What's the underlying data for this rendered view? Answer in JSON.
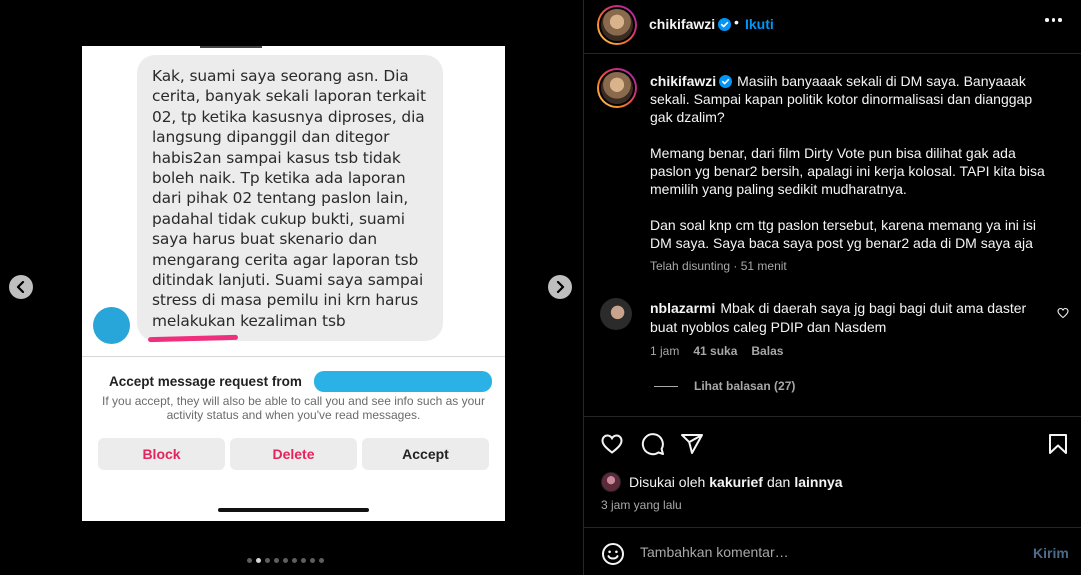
{
  "post": {
    "media": {
      "screenshot": {
        "message": "Kak, suami saya seorang asn. Dia cerita, banyak sekali laporan terkait 02, tp ketika kasusnya diproses, dia langsung dipanggil dan ditegor habis2an sampai kasus tsb tidak boleh naik. Tp ketika ada laporan dari pihak 02 tentang paslon lain, padahal tidak cukup bukti, suami saya harus buat skenario dan mengarang cerita agar laporan tsb ditindak lanjuti. Suami saya sampai stress di masa pemilu ini krn harus melakukan kezaliman tsb",
        "request_title": "Accept message request from",
        "request_info": "If you accept, they will also be able to call you and see info such as your activity status and when you've read messages.",
        "buttons": {
          "block": "Block",
          "delete": "Delete",
          "accept": "Accept"
        }
      },
      "carousel": {
        "total": 9,
        "active_index": 1
      }
    },
    "header": {
      "username": "chikifawzi",
      "separator": "•",
      "follow_label": "Ikuti"
    },
    "caption": {
      "username": "chikifawzi",
      "paragraphs": [
        "Masiih banyaaak sekali di DM saya. Banyaaak sekali. Sampai kapan politik kotor dinormalisasi dan dianggap gak dzalim?",
        "Memang benar, dari film Dirty Vote pun bisa dilihat gak ada paslon yg benar2 bersih, apalagi ini kerja kolosal. TAPI kita bisa memilih yang paling sedikit mudharatnya.",
        "Dan soal knp cm ttg paslon tersebut, karena memang ya ini isi DM saya. Saya baca saya post yg benar2 ada di DM saya aja"
      ],
      "meta": "Telah disunting · 51 menit"
    },
    "comment": {
      "username": "nblazarmi",
      "text": "Mbak di daerah saya jg bagi bagi duit ama daster buat nyoblos caleg PDIP dan Nasdem",
      "time": "1 jam",
      "likes": "41 suka",
      "reply_label": "Balas",
      "view_replies": "Lihat balasan (27)"
    },
    "likes": {
      "prefix": "Disukai oleh",
      "user": "kakurief",
      "conjunction": "dan",
      "others": "lainnya"
    },
    "time_ago": "3 jam yang lalu",
    "comment_box": {
      "placeholder": "Tambahkan komentar…",
      "post_label": "Kirim"
    },
    "colors": {
      "accent": "#0095f6",
      "verified": "#0095f6",
      "danger": "#e5245e",
      "muted": "#a8a8a8"
    },
    "icons": [
      "chevron-left-icon",
      "chevron-right-icon",
      "verified-icon",
      "more-icon",
      "heart-icon",
      "comment-icon",
      "share-icon",
      "bookmark-icon",
      "emoji-icon"
    ]
  }
}
